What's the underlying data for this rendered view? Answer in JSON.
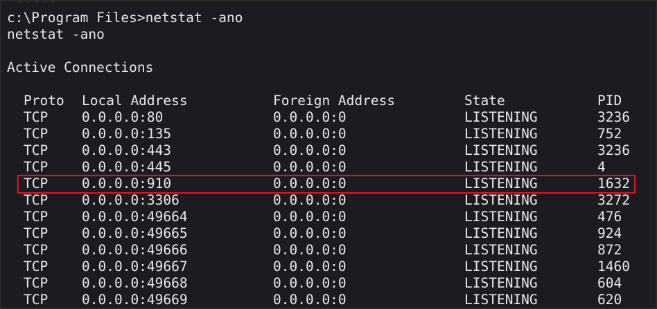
{
  "terminal": {
    "command_line": "c:\\Program Files>netstat -ano",
    "echo_line": "netstat -ano",
    "section_title": "Active Connections",
    "top_ghost_text": "· · · · ·"
  },
  "table": {
    "headers": {
      "proto": "Proto",
      "local": "Local Address",
      "foreign": "Foreign Address",
      "state": "State",
      "pid": "PID"
    },
    "rows": [
      {
        "proto": "TCP",
        "local": "0.0.0.0:80",
        "foreign": "0.0.0.0:0",
        "state": "LISTENING",
        "pid": "3236"
      },
      {
        "proto": "TCP",
        "local": "0.0.0.0:135",
        "foreign": "0.0.0.0:0",
        "state": "LISTENING",
        "pid": "752"
      },
      {
        "proto": "TCP",
        "local": "0.0.0.0:443",
        "foreign": "0.0.0.0:0",
        "state": "LISTENING",
        "pid": "3236"
      },
      {
        "proto": "TCP",
        "local": "0.0.0.0:445",
        "foreign": "0.0.0.0:0",
        "state": "LISTENING",
        "pid": "4"
      },
      {
        "proto": "TCP",
        "local": "0.0.0.0:910",
        "foreign": "0.0.0.0:0",
        "state": "LISTENING",
        "pid": "1632"
      },
      {
        "proto": "TCP",
        "local": "0.0.0.0:3306",
        "foreign": "0.0.0.0:0",
        "state": "LISTENING",
        "pid": "3272"
      },
      {
        "proto": "TCP",
        "local": "0.0.0.0:49664",
        "foreign": "0.0.0.0:0",
        "state": "LISTENING",
        "pid": "476"
      },
      {
        "proto": "TCP",
        "local": "0.0.0.0:49665",
        "foreign": "0.0.0.0:0",
        "state": "LISTENING",
        "pid": "924"
      },
      {
        "proto": "TCP",
        "local": "0.0.0.0:49666",
        "foreign": "0.0.0.0:0",
        "state": "LISTENING",
        "pid": "872"
      },
      {
        "proto": "TCP",
        "local": "0.0.0.0:49667",
        "foreign": "0.0.0.0:0",
        "state": "LISTENING",
        "pid": "1460"
      },
      {
        "proto": "TCP",
        "local": "0.0.0.0:49668",
        "foreign": "0.0.0.0:0",
        "state": "LISTENING",
        "pid": "604"
      },
      {
        "proto": "TCP",
        "local": "0.0.0.0:49669",
        "foreign": "0.0.0.0:0",
        "state": "LISTENING",
        "pid": "620"
      }
    ]
  },
  "colors": {
    "background": "#1c1b22",
    "text": "#e8e8ea",
    "highlight_border": "#c41e25"
  }
}
